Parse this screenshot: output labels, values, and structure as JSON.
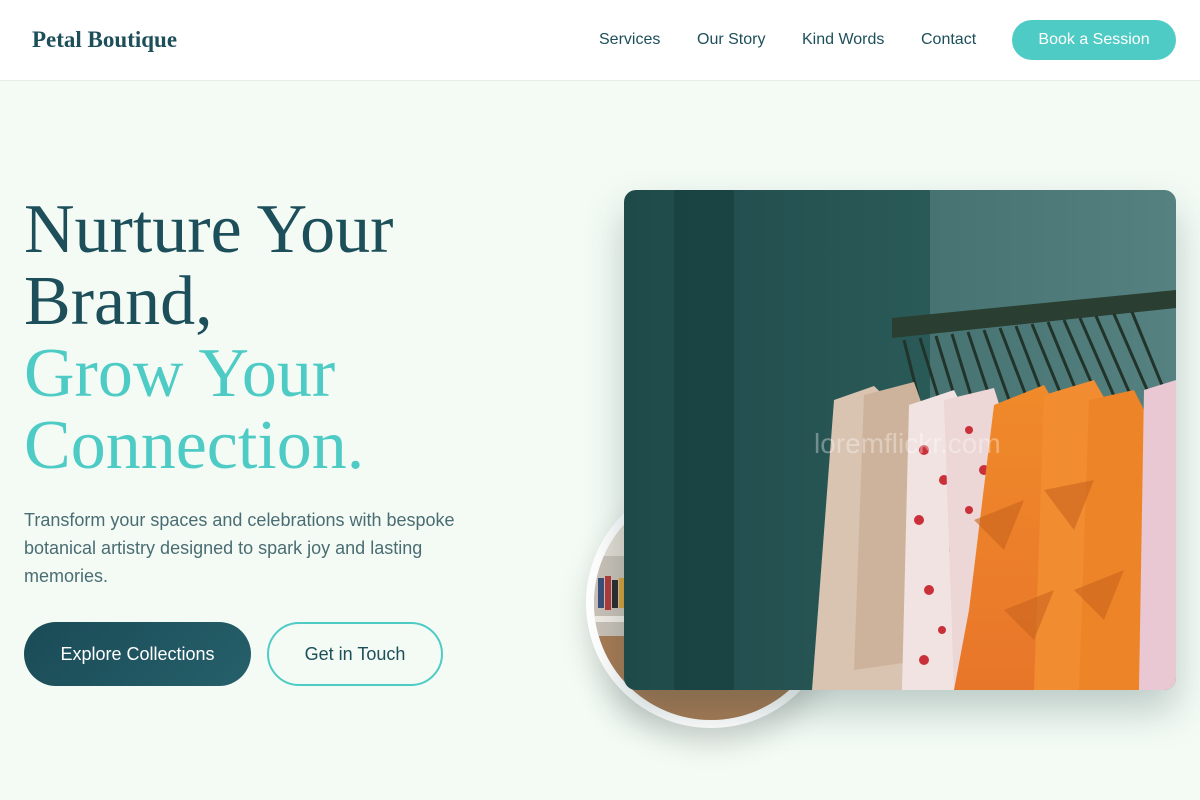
{
  "header": {
    "logo": "Petal Boutique",
    "nav": [
      "Services",
      "Our Story",
      "Kind Words",
      "Contact"
    ],
    "cta": "Book a Session"
  },
  "hero": {
    "title_line1": "Nurture Your",
    "title_line2": "Brand,",
    "title_line3": "Grow Your",
    "title_line4": "Connection.",
    "subtitle": "Transform your spaces and celebrations with bespoke botanical artistry designed to spark joy and lasting memories.",
    "primary_button": "Explore Collections",
    "secondary_button": "Get in Touch",
    "image_watermark": "loremflickr.com"
  },
  "colors": {
    "primary": "#1d4f5a",
    "accent": "#4ecbc4",
    "background": "#f4fbf5"
  }
}
